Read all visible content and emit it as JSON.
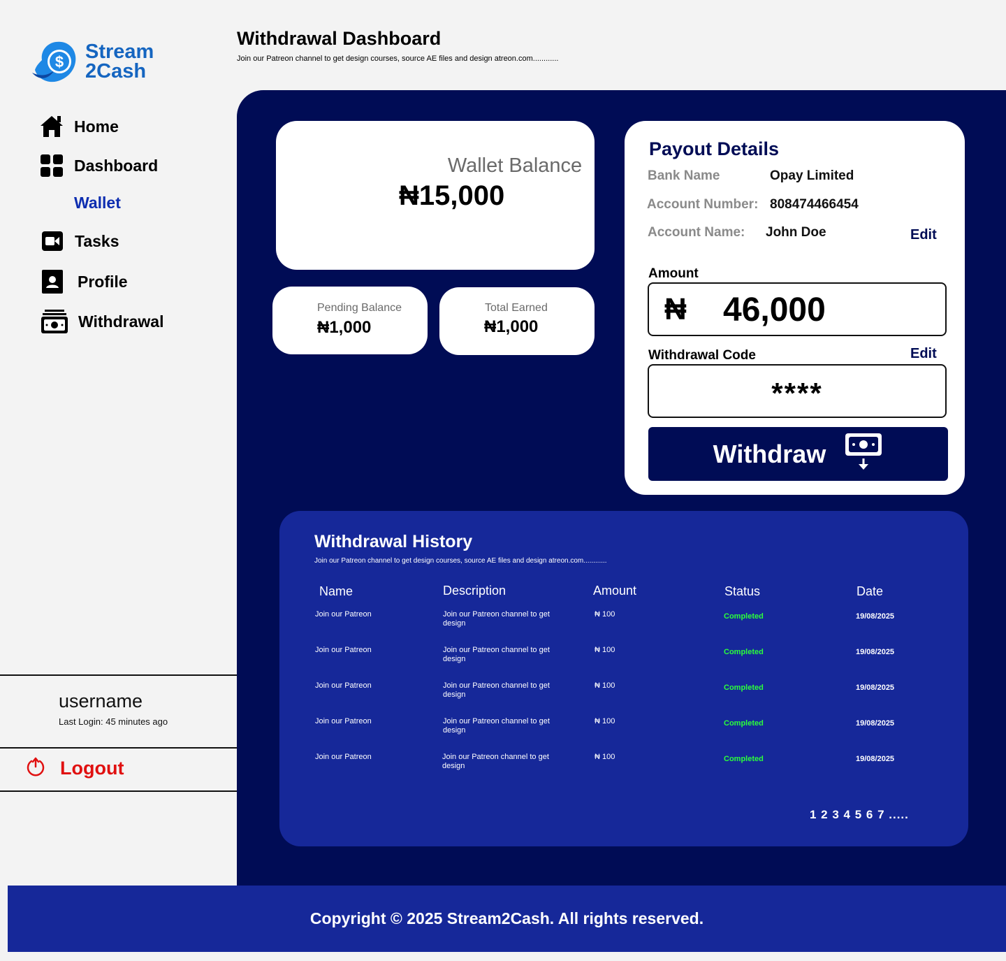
{
  "brand": {
    "line1": "Stream",
    "line2": "2Cash"
  },
  "sidebar": {
    "items": [
      {
        "label": "Home",
        "icon": "home-icon"
      },
      {
        "label": "Dashboard",
        "icon": "grid-icon"
      },
      {
        "label": "Wallet",
        "icon": ""
      },
      {
        "label": "Tasks",
        "icon": "video-icon"
      },
      {
        "label": "Profile",
        "icon": "user-icon"
      },
      {
        "label": "Withdrawal",
        "icon": "cash-icon"
      }
    ],
    "username": "username",
    "last_login": "Last Login: 45 minutes ago",
    "logout_label": "Logout"
  },
  "header": {
    "title": "Withdrawal Dashboard",
    "subtitle": "Join our Patreon channel to get design courses, source AE files and design atreon.com............"
  },
  "wallet": {
    "label": "Wallet Balance",
    "value": "₦15,000"
  },
  "pending": {
    "label": "Pending Balance",
    "value": "₦1,000"
  },
  "earned": {
    "label": "Total Earned",
    "value": "₦1,000"
  },
  "payout": {
    "title": "Payout Details",
    "bank_name_key": "Bank Name",
    "bank_name": "Opay Limited",
    "account_number_key": "Account Number:",
    "account_number": "808474466454",
    "account_name_key": "Account Name:",
    "account_name": "John Doe",
    "edit_label": "Edit",
    "amount_label": "Amount",
    "amount_currency": "₦",
    "amount_value": "46,000",
    "code_label": "Withdrawal Code",
    "code_edit_label": "Edit",
    "code_value": "****",
    "withdraw_label": "Withdraw"
  },
  "history": {
    "title": "Withdrawal History",
    "subtitle": "Join our Patreon channel to get design courses, source AE files and design atreon.com............",
    "columns": [
      "Name",
      "Description",
      "Amount",
      "Status",
      "Date"
    ],
    "rows": [
      {
        "name": "Join our Patreon",
        "description": "Join our Patreon channel to get design",
        "amount": "₦ 100",
        "status": "Completed",
        "date": "19/08/2025"
      },
      {
        "name": "Join our Patreon",
        "description": "Join our Patreon channel to get design",
        "amount": "₦ 100",
        "status": "Completed",
        "date": "19/08/2025"
      },
      {
        "name": "Join our Patreon",
        "description": "Join our Patreon channel to get design",
        "amount": "₦ 100",
        "status": "Completed",
        "date": "19/08/2025"
      },
      {
        "name": "Join our Patreon",
        "description": "Join our Patreon channel to get design",
        "amount": "₦ 100",
        "status": "Completed",
        "date": "19/08/2025"
      },
      {
        "name": "Join our Patreon",
        "description": "Join our Patreon channel to get design",
        "amount": "₦ 100",
        "status": "Completed",
        "date": "19/08/2025"
      }
    ],
    "pagination": "1 2 3 4 5 6 7 ....."
  },
  "footer": {
    "text": "Copyright © 2025 Stream2Cash. All rights reserved."
  },
  "colors": {
    "navy": "#000c55",
    "blue": "#162899",
    "brand": "#1565c0",
    "logout": "#e01010",
    "status": "#2bff3b"
  }
}
